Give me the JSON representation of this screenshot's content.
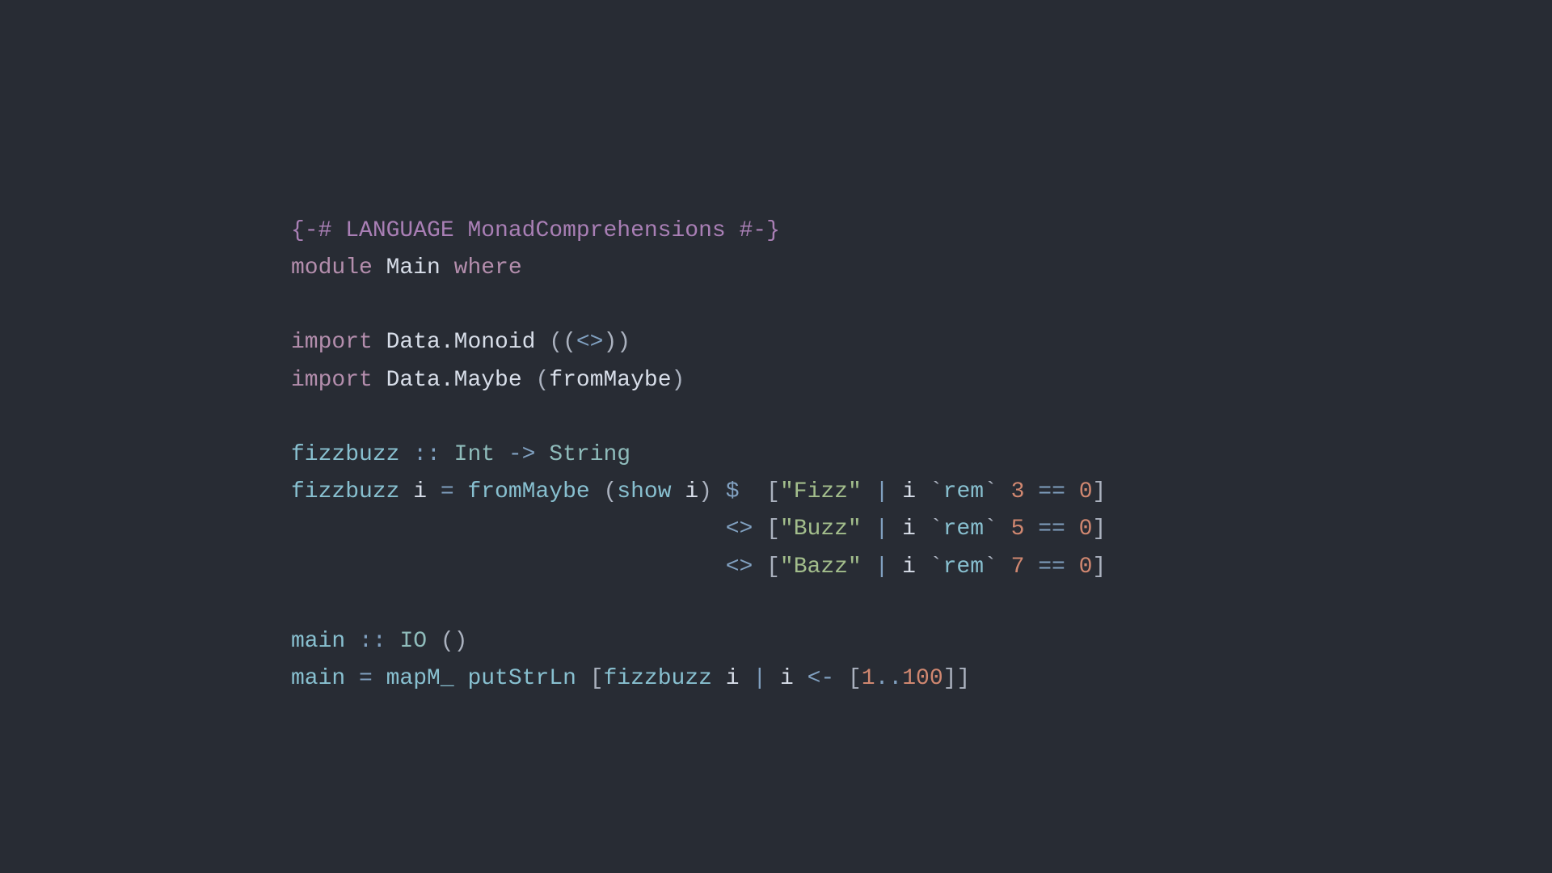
{
  "pragma": {
    "open": "{-# ",
    "language_kw": "LANGUAGE",
    "extension": " MonadComprehensions ",
    "close": "#-}"
  },
  "module_decl": {
    "module_kw": "module",
    "name": " Main ",
    "where_kw": "where"
  },
  "imports": [
    {
      "import_kw": "import",
      "module": " Data.Monoid ",
      "open": "((",
      "symbol": "<>",
      "close": "))"
    },
    {
      "import_kw": "import",
      "module": " Data.Maybe ",
      "open": "(",
      "symbol": "fromMaybe",
      "close": ")"
    }
  ],
  "typesig1": {
    "name": "fizzbuzz ",
    "dcolon": ":: ",
    "type1": "Int",
    "arrow": " -> ",
    "type2": "String"
  },
  "def1": {
    "line1": {
      "name": "fizzbuzz ",
      "param": "i ",
      "eq": "= ",
      "fn": "fromMaybe ",
      "lparen": "(",
      "show": "show ",
      "arg": "i",
      "rparen": ") ",
      "dollar": "$  ",
      "lbracket": "[",
      "str": "\"Fizz\"",
      "pipe": " | ",
      "var": "i ",
      "btick1": "`",
      "rem": "rem",
      "btick2": "` ",
      "num": "3",
      "eqeq": " == ",
      "zero": "0",
      "rbracket": "]"
    },
    "line2": {
      "indent": "                                ",
      "op": "<> ",
      "lbracket": "[",
      "str": "\"Buzz\"",
      "pipe": " | ",
      "var": "i ",
      "btick1": "`",
      "rem": "rem",
      "btick2": "` ",
      "num": "5",
      "eqeq": " == ",
      "zero": "0",
      "rbracket": "]"
    },
    "line3": {
      "indent": "                                ",
      "op": "<> ",
      "lbracket": "[",
      "str": "\"Bazz\"",
      "pipe": " | ",
      "var": "i ",
      "btick1": "`",
      "rem": "rem",
      "btick2": "` ",
      "num": "7",
      "eqeq": " == ",
      "zero": "0",
      "rbracket": "]"
    }
  },
  "typesig2": {
    "name": "main ",
    "dcolon": ":: ",
    "type1": "IO",
    "unit": " ()"
  },
  "def2": {
    "name": "main ",
    "eq": "= ",
    "mapm": "mapM_ ",
    "put": "putStrLn ",
    "lbracket": "[",
    "fn": "fizzbuzz ",
    "var1": "i ",
    "pipe": "| ",
    "var2": "i ",
    "arrow": "<- ",
    "lbracket2": "[",
    "one": "1",
    "dots": "..",
    "hundred": "100",
    "rbracket2": "]",
    "rbracket": "]"
  }
}
